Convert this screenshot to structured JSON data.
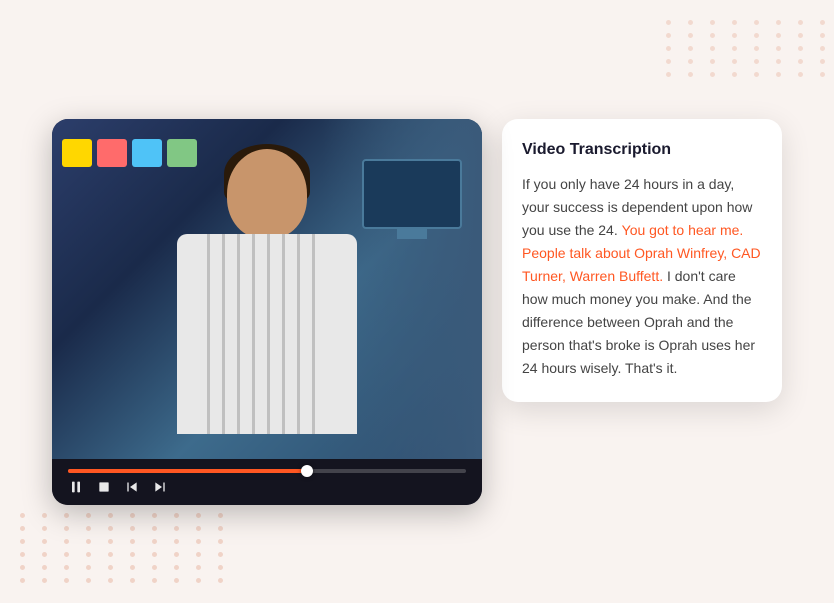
{
  "page": {
    "bg_color": "#f9f3f0"
  },
  "video_player": {
    "controls": {
      "pause_label": "⏸",
      "stop_label": "⏹",
      "skip_back_label": "⏮",
      "skip_forward_label": "⏭"
    },
    "progress_percent": 60
  },
  "transcription": {
    "title": "Video Transcription",
    "text_normal_1": "If you only have 24 hours in a day, your success is dependent upon how you use the 24.",
    "text_highlighted": "You got to hear me. People talk about Oprah Winfrey, CAD Turner, Warren Buffett.",
    "text_normal_2": "I don't care how much money you make. And the difference between Oprah and the person that's broke is Oprah uses her 24 hours wisely. That's it."
  },
  "sticky_notes": [
    {
      "color": "#ffd700"
    },
    {
      "color": "#ff6b6b"
    },
    {
      "color": "#4fc3f7"
    },
    {
      "color": "#81c784"
    }
  ]
}
